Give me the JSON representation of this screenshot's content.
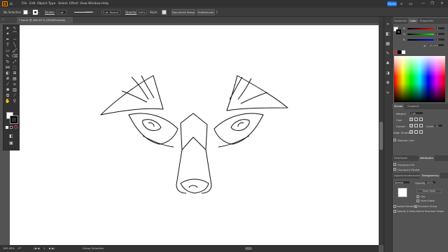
{
  "menubar": {
    "logo": "Ai",
    "items": [
      "File",
      "Edit",
      "Object",
      "Type",
      "Select",
      "Effect",
      "View",
      "Window",
      "Help"
    ],
    "share_label": "Share",
    "window_controls": [
      "—",
      "❐",
      "✕"
    ]
  },
  "controlbar": {
    "selection": "No Selection",
    "stroke_label": "Stroke:",
    "stroke_value": "1 pt",
    "uniform_label": "Uniform",
    "brush_value": "5 pt. Round",
    "opacity_label": "Opacity:",
    "opacity_value": "100%",
    "style_label": "Style:",
    "doc_setup": "Document Setup",
    "preferences": "Preferences"
  },
  "document": {
    "tab_title": "* fox.ai @ 165.49 % (RGB/Preview)"
  },
  "statusbar": {
    "zoom": "165.49%",
    "rotation": "0°",
    "artboard": "1",
    "tool": "Group Selection"
  },
  "panels": {
    "top_tabs": [
      "Swatches",
      "Color",
      "Properties"
    ],
    "color": {
      "channels": [
        {
          "name": "R",
          "value": "0",
          "color": "#ff4040"
        },
        {
          "name": "G",
          "value": "0",
          "color": "#40c040"
        },
        {
          "name": "B",
          "value": "0",
          "color": "#4070ff"
        }
      ],
      "hex": "000000"
    },
    "stroke_tabs": [
      "Stroke",
      "Gradient"
    ],
    "stroke": {
      "weight_label": "Weight:",
      "weight_value": "1 pt",
      "cap_label": "Cap:",
      "corner_label": "Corner:",
      "limit_label": "Limit:",
      "limit_value": "10",
      "align_label": "Align Stroke:",
      "dashed_label": "Dashed Line"
    },
    "transparency_tabs": [
      "Appearance",
      "Libraries",
      "Transparency"
    ],
    "mid_tabs": [
      "Pathfinder",
      "Attributes"
    ],
    "attributes": {
      "overprint_fill": "Overprint Fill",
      "overprint_stroke": "Overprint Stroke"
    },
    "transparency": {
      "mode": "Normal",
      "opacity_label": "Opacity:",
      "opacity_value": "100%",
      "make_mask": "Make Mask",
      "clip": "Clip",
      "invert": "Invert Mask",
      "isolate": "Isolate Blending",
      "knockout": "Knockout Group",
      "opacity_mask": "Opacity & Mask Define Knockout Shape"
    }
  }
}
